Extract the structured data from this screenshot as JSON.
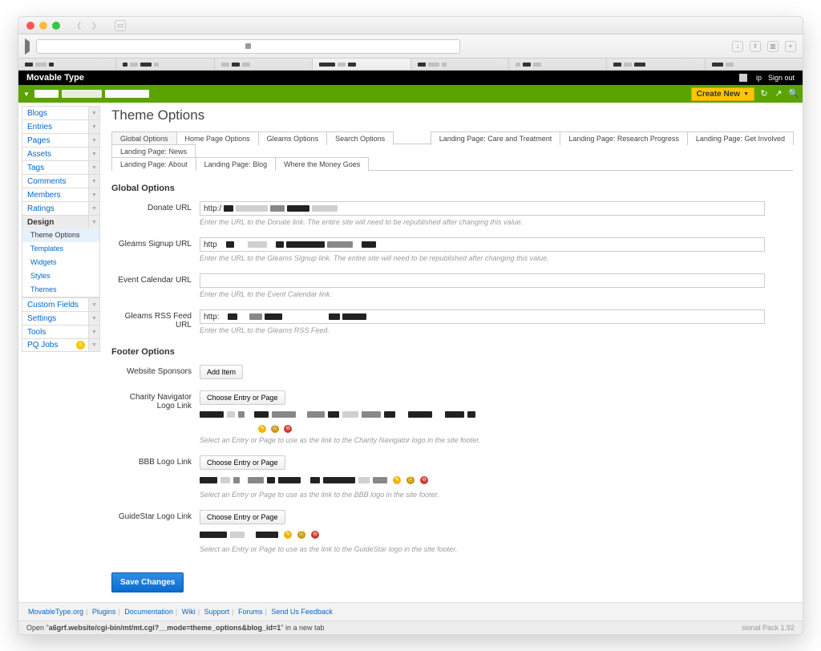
{
  "app": {
    "name": "Movable Type"
  },
  "header": {
    "user": "ip",
    "signout": "Sign out",
    "create_new": "Create New"
  },
  "sidebar": {
    "items": [
      {
        "label": "Blogs"
      },
      {
        "label": "Entries"
      },
      {
        "label": "Pages"
      },
      {
        "label": "Assets"
      },
      {
        "label": "Tags"
      },
      {
        "label": "Comments"
      },
      {
        "label": "Members"
      },
      {
        "label": "Ratings"
      },
      {
        "label": "Design",
        "active": true,
        "sub": [
          {
            "label": "Theme Options",
            "active": true
          },
          {
            "label": "Templates"
          },
          {
            "label": "Widgets"
          },
          {
            "label": "Styles"
          },
          {
            "label": "Themes"
          }
        ]
      },
      {
        "label": "Custom Fields"
      },
      {
        "label": "Settings"
      },
      {
        "label": "Tools"
      },
      {
        "label": "PQ Jobs",
        "badge": "0"
      }
    ]
  },
  "page": {
    "title": "Theme Options"
  },
  "tabs": [
    "Global Options",
    "Home Page Options",
    "Gleams Options",
    "Search Options",
    "",
    "Landing Page: Care and Treatment",
    "Landing Page: Research Progress",
    "Landing Page: Get Involved",
    "Landing Page: News",
    "Landing Page: About",
    "Landing Page: Blog",
    "Where the Money Goes"
  ],
  "sections": {
    "global": {
      "title": "Global Options",
      "rows": [
        {
          "label": "Donate URL",
          "prefix": "http:/",
          "hint": "Enter the URL to the Donate link. The entire site will need to be republished after changing this value."
        },
        {
          "label": "Gleams Signup URL",
          "prefix": "http",
          "hint": "Enter the URL to the Gleams Signup link. The entire site will need to be republished after changing this value."
        },
        {
          "label": "Event Calendar URL",
          "hint": "Enter the URL to the Event Calendar link."
        },
        {
          "label": "Gleams RSS Feed URL",
          "prefix": "http:",
          "hint": "Enter the URL to the Gleams RSS Feed."
        }
      ]
    },
    "footer": {
      "title": "Footer Options",
      "rows": [
        {
          "label": "Website Sponsors",
          "btn": "Add Item"
        },
        {
          "label": "Charity Navigator Logo Link",
          "btn": "Choose Entry or Page",
          "hint": "Select an Entry or Page to use as the link to the Charity Navigator logo in the site footer."
        },
        {
          "label": "BBB Logo Link",
          "btn": "Choose Entry or Page",
          "hint": "Select an Entry or Page to use as the link to the BBB logo in the site footer."
        },
        {
          "label": "GuideStar Logo Link",
          "btn": "Choose Entry or Page",
          "hint": "Select an Entry or Page to use as the link to the GuideStar logo in the site footer."
        }
      ]
    }
  },
  "save": "Save Changes",
  "footerlinks": [
    "MovableType.org",
    "Plugins",
    "Documentation",
    "Wiki",
    "Support",
    "Forums",
    "Send Us Feedback"
  ],
  "status": {
    "pre": "Open \"",
    "url": "a6grf.website/cgi-bin/mt/mt.cgi?__mode=theme_options&blog_id=1",
    "post": "\" in a new tab",
    "right": "sional Pack 1.92"
  }
}
